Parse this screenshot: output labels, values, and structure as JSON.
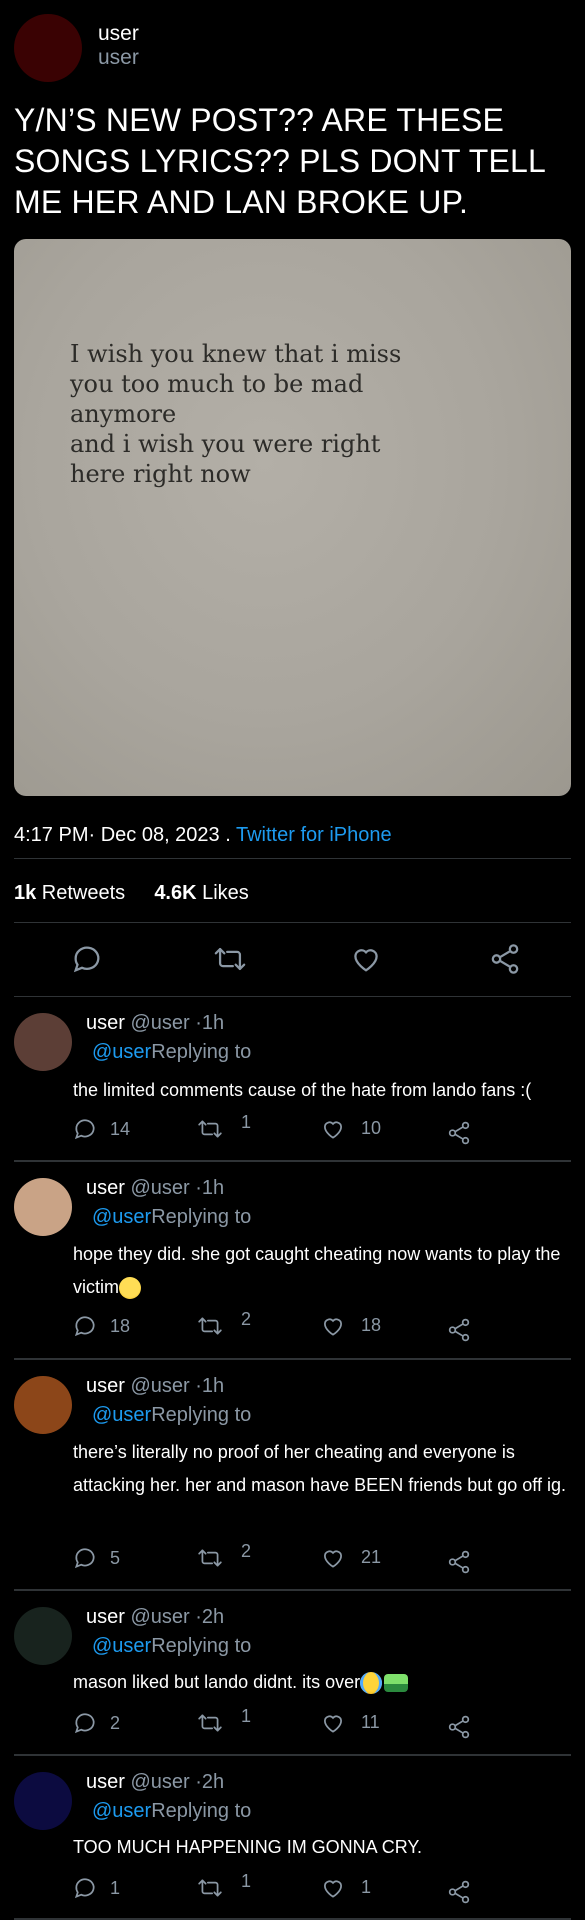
{
  "header": {
    "name": "user",
    "handle": "user",
    "avatar_color": "#3a0203"
  },
  "post": {
    "text": "Y/N’S NEW POST?? ARE THESE SONGS LYRICS?? PLS DONT TELL ME HER AND LAN BROKE UP.",
    "image_lines": [
      "I wish you knew that i miss",
      "you too much to be mad",
      "anymore",
      "and i wish you were right",
      "here right now"
    ],
    "time": "4:17 PM· Dec 08, 2023 . ",
    "source": "Twitter for iPhone",
    "retweets_count": "1k",
    "retweets_label": " Retweets",
    "likes_count": "4.6K",
    "likes_label": " Likes"
  },
  "actions": {
    "icons": [
      "reply-icon",
      "retweet-icon",
      "like-icon",
      "share-icon"
    ]
  },
  "replies": [
    {
      "name": "user",
      "handle": "@user",
      "time": "·1h",
      "mention": "@user",
      "replying": "Replying to",
      "text": "the limited comments cause of the hate from lando fans :(",
      "replies": "14",
      "retweets": "1",
      "likes": "10",
      "avatar_color": "#5c3e36"
    },
    {
      "name": "user",
      "handle": "@user",
      "time": "·1h",
      "mention": "@user",
      "replying": "Replying to",
      "text": "hope they did. she got caught cheating now wants to play the victim",
      "emoji": "flushed-face",
      "replies": "18",
      "retweets": "2",
      "likes": "18",
      "avatar_color": "#c9a386"
    },
    {
      "name": "user",
      "handle": "@user",
      "time": "·1h",
      "mention": "@user",
      "replying": "Replying to",
      "text": "there’s literally no proof of her cheating and everyone is attacking her. her and mason have BEEN friends but go off ig.",
      "replies": "5",
      "retweets": "2",
      "likes": "21",
      "avatar_color": "#8c4619"
    },
    {
      "name": "user",
      "handle": "@user",
      "time": "·2h",
      "mention": "@user",
      "replying": "Replying to",
      "text": "mason liked but lando didnt. its over",
      "emoji": "crying-face",
      "emoji2": "water-pistol",
      "replies": "2",
      "retweets": "1",
      "likes": "11",
      "avatar_color": "#18231e"
    },
    {
      "name": "user",
      "handle": "@user",
      "time": "·2h",
      "mention": "@user",
      "replying": "Replying to",
      "text": "TOO MUCH HAPPENING IM GONNA CRY.",
      "replies": "1",
      "retweets": "1",
      "likes": "1",
      "avatar_color": "#0c0b40"
    }
  ]
}
